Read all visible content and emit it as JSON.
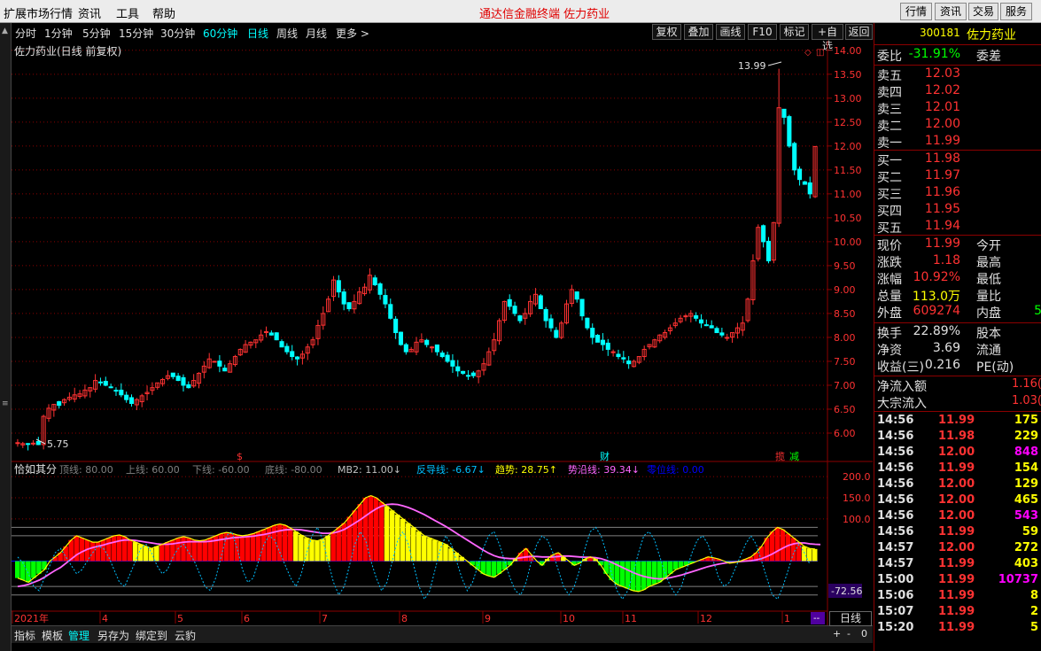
{
  "menubar": {
    "items": [
      "扩展市场行情",
      "资讯",
      "工具",
      "帮助"
    ],
    "center_title": "通达信金融终端   佐力药业",
    "right_buttons": [
      "行情",
      "资讯",
      "交易",
      "服务"
    ]
  },
  "toolbar": {
    "periods": [
      "分时",
      "1分钟",
      "5分钟",
      "15分钟",
      "30分钟",
      "60分钟",
      "日线",
      "周线",
      "月线",
      "更多 >"
    ],
    "active_period": "日线",
    "buttons": [
      "复权",
      "叠加",
      "画线",
      "F10",
      "标记",
      "+自选",
      "返回"
    ]
  },
  "chart_title": "佐力药业(日线 前复权)",
  "chart_data": [
    {
      "type": "candlestick",
      "title": "佐力药业(日线 前复权)",
      "y_ticks": [
        "14.00",
        "13.50",
        "13.00",
        "12.50",
        "12.00",
        "11.50",
        "11.00",
        "10.50",
        "10.00",
        "9.50",
        "9.00",
        "8.50",
        "8.00",
        "7.50",
        "7.00",
        "6.50",
        "6.00"
      ],
      "ylim": [
        5.5,
        14.2
      ],
      "annotations": {
        "high_label": "13.99",
        "low_label": "5.75"
      },
      "markers": [
        "$",
        "财",
        "揽",
        "减"
      ],
      "close": [
        5.8,
        5.78,
        5.77,
        5.79,
        5.76,
        6.35,
        6.52,
        6.6,
        6.58,
        6.7,
        6.75,
        6.8,
        6.82,
        6.9,
        6.95,
        7.1,
        7.05,
        7.0,
        6.95,
        6.88,
        6.8,
        6.7,
        6.62,
        6.7,
        6.78,
        6.85,
        6.95,
        7.05,
        7.12,
        7.2,
        7.18,
        7.1,
        7.0,
        6.95,
        7.1,
        7.25,
        7.4,
        7.55,
        7.5,
        7.4,
        7.3,
        7.45,
        7.6,
        7.75,
        7.85,
        7.9,
        7.95,
        8.05,
        8.12,
        8.05,
        7.95,
        7.8,
        7.7,
        7.6,
        7.55,
        7.65,
        7.8,
        7.95,
        8.25,
        8.5,
        8.8,
        9.2,
        8.95,
        8.7,
        8.6,
        8.75,
        8.95,
        9.05,
        9.3,
        9.1,
        8.9,
        8.7,
        8.4,
        8.1,
        7.85,
        7.7,
        7.75,
        7.9,
        7.95,
        7.85,
        7.8,
        7.7,
        7.6,
        7.5,
        7.4,
        7.3,
        7.25,
        7.2,
        7.2,
        7.3,
        7.45,
        7.7,
        7.95,
        8.35,
        8.75,
        8.65,
        8.5,
        8.35,
        8.5,
        8.75,
        8.9,
        8.6,
        8.35,
        8.2,
        8.0,
        8.3,
        8.7,
        9.0,
        8.8,
        8.45,
        8.2,
        8.0,
        7.9,
        7.85,
        7.75,
        7.7,
        7.6,
        7.55,
        7.45,
        7.5,
        7.6,
        7.75,
        7.85,
        7.95,
        8.05,
        8.1,
        8.2,
        8.3,
        8.4,
        8.45,
        8.5,
        8.4,
        8.3,
        8.25,
        8.2,
        8.1,
        8.05,
        8.0,
        8.1,
        8.2,
        8.3,
        8.8,
        9.6,
        10.3,
        10.0,
        9.6,
        10.4,
        12.8,
        12.6,
        12.0,
        11.5,
        11.3,
        11.2,
        11.0,
        11.99
      ],
      "series": [
        {
          "name": "MB2",
          "values_note": ""
        }
      ]
    },
    {
      "type": "indicator",
      "title": "恰如其分",
      "legend": [
        {
          "label": "顶线: 80.00",
          "color": "#808080"
        },
        {
          "label": "上线: 60.00",
          "color": "#808080"
        },
        {
          "label": "下线: -60.00",
          "color": "#808080"
        },
        {
          "label": "底线: -80.00",
          "color": "#808080"
        },
        {
          "label": "MB2: 11.00↓",
          "color": "#c0c0c0"
        },
        {
          "label": "反导线: -6.67↓",
          "color": "#00bfff"
        },
        {
          "label": "趋势: 28.75↑",
          "color": "#ffff00"
        },
        {
          "label": "势沿线: 39.34↓",
          "color": "#ff66ff"
        },
        {
          "label": "零位线: 0.00",
          "color": "#0000ff"
        }
      ],
      "y_ticks": [
        "200.0",
        "150.0",
        "100.0"
      ],
      "ylim": [
        -110,
        215
      ],
      "reference_lines": [
        80,
        60,
        -60,
        -80
      ],
      "current_value_label": "-72.56",
      "trend": [
        -40,
        -45,
        -50,
        -40,
        -30,
        -20,
        0,
        10,
        20,
        35,
        50,
        60,
        55,
        50,
        45,
        45,
        50,
        55,
        60,
        62,
        58,
        50,
        45,
        40,
        35,
        30,
        35,
        40,
        45,
        50,
        55,
        58,
        55,
        50,
        48,
        50,
        55,
        60,
        65,
        68,
        66,
        62,
        60,
        62,
        65,
        70,
        75,
        80,
        85,
        88,
        85,
        78,
        70,
        62,
        55,
        50,
        48,
        52,
        60,
        70,
        80,
        90,
        105,
        120,
        135,
        150,
        155,
        150,
        140,
        130,
        120,
        110,
        100,
        90,
        80,
        70,
        60,
        55,
        50,
        45,
        40,
        30,
        20,
        10,
        0,
        -10,
        -20,
        -30,
        -35,
        -38,
        -30,
        -20,
        -10,
        5,
        20,
        30,
        15,
        0,
        -10,
        5,
        15,
        20,
        10,
        0,
        -10,
        -5,
        5,
        10,
        5,
        -10,
        -30,
        -45,
        -55,
        -60,
        -65,
        -70,
        -72,
        -68,
        -60,
        -55,
        -50,
        -40,
        -30,
        -20,
        -15,
        -10,
        -5,
        0,
        5,
        10,
        8,
        5,
        0,
        -5,
        -3,
        0,
        5,
        10,
        20,
        35,
        55,
        70,
        80,
        75,
        65,
        55,
        45,
        35,
        30,
        28.75
      ],
      "trend_line": [
        -60,
        -58,
        -55,
        -50,
        -45,
        -38,
        -30,
        -22,
        -15,
        -5,
        5,
        15,
        22,
        28,
        32,
        35,
        38,
        42,
        45,
        48,
        50,
        50,
        49,
        47,
        45,
        43,
        41,
        40,
        40,
        41,
        43,
        45,
        46,
        46,
        46,
        46,
        47,
        49,
        51,
        53,
        55,
        56,
        57,
        58,
        59,
        61,
        63,
        66,
        69,
        72,
        74,
        75,
        75,
        74,
        72,
        70,
        68,
        66,
        66,
        67,
        70,
        75,
        82,
        90,
        98,
        107,
        116,
        124,
        130,
        134,
        135,
        134,
        131,
        127,
        122,
        116,
        110,
        103,
        96,
        89,
        82,
        74,
        66,
        58,
        50,
        42,
        34,
        26,
        19,
        13,
        9,
        7,
        6,
        6,
        8,
        10,
        11,
        11,
        10,
        10,
        10,
        11,
        12,
        12,
        11,
        10,
        9,
        9,
        8,
        6,
        2,
        -3,
        -9,
        -15,
        -21,
        -27,
        -32,
        -36,
        -39,
        -41,
        -42,
        -41,
        -39,
        -36,
        -33,
        -29,
        -25,
        -21,
        -17,
        -13,
        -10,
        -7,
        -5,
        -3,
        -2,
        -1,
        0,
        1,
        3,
        6,
        11,
        17,
        24,
        31,
        37,
        41,
        43,
        43,
        41,
        40,
        39.34
      ],
      "anti": [
        10,
        -5,
        -30,
        -60,
        -70,
        -40,
        -10,
        20,
        30,
        10,
        -10,
        -30,
        -20,
        0,
        20,
        35,
        30,
        10,
        -20,
        -50,
        -60,
        -30,
        0,
        30,
        40,
        20,
        -10,
        -30,
        -20,
        10,
        30,
        40,
        20,
        0,
        -30,
        -60,
        -70,
        -40,
        10,
        60,
        70,
        30,
        -20,
        -50,
        -40,
        0,
        40,
        60,
        50,
        20,
        -10,
        -40,
        -60,
        -30,
        20,
        60,
        80,
        50,
        0,
        -50,
        -80,
        -60,
        -10,
        40,
        70,
        50,
        0,
        -40,
        -70,
        -50,
        0,
        50,
        70,
        40,
        -10,
        -60,
        -90,
        -70,
        -20,
        30,
        60,
        40,
        0,
        -40,
        -70,
        -50,
        -10,
        30,
        60,
        70,
        40,
        0,
        -40,
        -70,
        -80,
        -50,
        0,
        40,
        60,
        50,
        20,
        -20,
        -60,
        -80,
        -60,
        -20,
        30,
        70,
        80,
        60,
        20,
        -30,
        -70,
        -90,
        -70,
        -30,
        20,
        60,
        70,
        50,
        10,
        -30,
        -60,
        -80,
        -60,
        -20,
        20,
        50,
        60,
        40,
        0,
        -40,
        -60,
        -50,
        -20,
        10,
        40,
        60,
        40,
        0,
        -40,
        -80,
        -90,
        -60,
        -20,
        20,
        40,
        20,
        -6.67
      ],
      "x_labels": [
        "2021年",
        "4",
        "5",
        "6",
        "7",
        "8",
        "9",
        "10",
        "11",
        "12",
        "1"
      ]
    }
  ],
  "rpanel": {
    "code": "300181",
    "name": "佐力药业",
    "weibi": {
      "label": "委比",
      "value": "-31.91%",
      "label2": "委差"
    },
    "asks": [
      {
        "label": "卖五",
        "price": "12.03"
      },
      {
        "label": "卖四",
        "price": "12.02"
      },
      {
        "label": "卖三",
        "price": "12.01"
      },
      {
        "label": "卖二",
        "price": "12.00"
      },
      {
        "label": "卖一",
        "price": "11.99"
      }
    ],
    "bids": [
      {
        "label": "买一",
        "price": "11.98"
      },
      {
        "label": "买二",
        "price": "11.97"
      },
      {
        "label": "买三",
        "price": "11.96"
      },
      {
        "label": "买四",
        "price": "11.95"
      },
      {
        "label": "买五",
        "price": "11.94"
      }
    ],
    "stats1": [
      {
        "label": "现价",
        "value": "11.99",
        "label2": "今开",
        "value2": "",
        "color": "red"
      },
      {
        "label": "涨跌",
        "value": "1.18",
        "label2": "最高",
        "value2": "",
        "color": "red"
      },
      {
        "label": "涨幅",
        "value": "10.92%",
        "label2": "最低",
        "value2": "",
        "color": "red"
      },
      {
        "label": "总量",
        "value": "113.0万",
        "label2": "量比",
        "value2": "",
        "color": "yellow"
      },
      {
        "label": "外盘",
        "value": "609274",
        "label2": "内盘",
        "value2": "5",
        "color": "red"
      }
    ],
    "stats2": [
      {
        "label": "换手",
        "value": "22.89%",
        "label2": "股本",
        "color": "white"
      },
      {
        "label": "净资",
        "value": "3.69",
        "label2": "流通",
        "color": "white"
      },
      {
        "label": "收益(三)",
        "value": "0.216",
        "label2": "PE(动)",
        "color": "white"
      }
    ],
    "flow": [
      {
        "label": "净流入额",
        "value": "1.16("
      },
      {
        "label": "大宗流入",
        "value": "1.03("
      }
    ],
    "ticks": [
      {
        "time": "14:56",
        "price": "11.99",
        "vol": "175",
        "vcolor": "yellow"
      },
      {
        "time": "14:56",
        "price": "11.98",
        "vol": "229",
        "vcolor": "yellow"
      },
      {
        "time": "14:56",
        "price": "12.00",
        "vol": "848",
        "vcolor": "purple"
      },
      {
        "time": "14:56",
        "price": "11.99",
        "vol": "154",
        "vcolor": "yellow"
      },
      {
        "time": "14:56",
        "price": "12.00",
        "vol": "129",
        "vcolor": "yellow"
      },
      {
        "time": "14:56",
        "price": "12.00",
        "vol": "465",
        "vcolor": "yellow"
      },
      {
        "time": "14:56",
        "price": "12.00",
        "vol": "543",
        "vcolor": "purple"
      },
      {
        "time": "14:56",
        "price": "11.99",
        "vol": "59",
        "vcolor": "yellow"
      },
      {
        "time": "14:57",
        "price": "12.00",
        "vol": "272",
        "vcolor": "yellow"
      },
      {
        "time": "14:57",
        "price": "11.99",
        "vol": "403",
        "vcolor": "yellow"
      },
      {
        "time": "15:00",
        "price": "11.99",
        "vol": "10737",
        "vcolor": "purple"
      },
      {
        "time": "15:06",
        "price": "11.99",
        "vol": "8",
        "vcolor": "yellow"
      },
      {
        "time": "15:07",
        "price": "11.99",
        "vol": "2",
        "vcolor": "yellow"
      },
      {
        "time": "15:20",
        "price": "11.99",
        "vol": "5",
        "vcolor": "yellow"
      }
    ]
  },
  "bottomtabs": {
    "items": [
      "指标",
      "模板",
      "管理",
      "另存为",
      "绑定到",
      "云豹"
    ],
    "active": "管理",
    "dayline": "日线",
    "zoom_plus": "+",
    "zoom_minus": "-",
    "zoom_zero": "0",
    "scroll_marker": "--"
  },
  "colors": {
    "up": "#ff3232",
    "down": "#00ffff",
    "grid": "#8b0000",
    "trend_pos": "#ff0000",
    "trend_neg": "#00ff00",
    "trend_line": "#ff66ff",
    "anti": "#00bfff"
  }
}
